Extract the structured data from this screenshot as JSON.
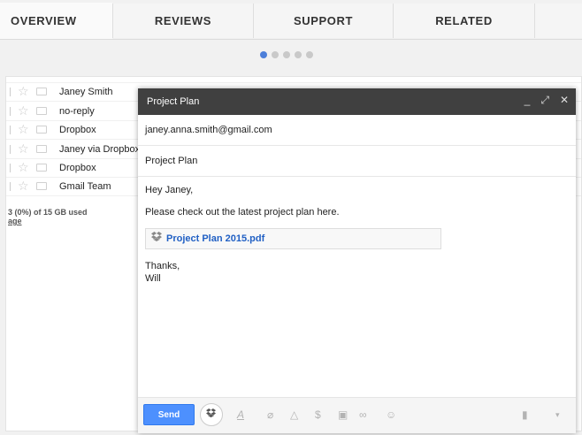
{
  "tabs": [
    {
      "label": "OVERVIEW"
    },
    {
      "label": "REVIEWS"
    },
    {
      "label": "SUPPORT"
    },
    {
      "label": "RELATED"
    }
  ],
  "carousel": {
    "active_index": 0,
    "count": 5
  },
  "inbox": {
    "rows": [
      {
        "sender": "Janey Smith"
      },
      {
        "sender": "no-reply"
      },
      {
        "sender": "Dropbox"
      },
      {
        "sender": "Janey via Dropbox"
      },
      {
        "sender": "Dropbox"
      },
      {
        "sender": "Gmail Team"
      }
    ],
    "storage_text": "3 (0%) of 15 GB used",
    "storage_link": "age"
  },
  "compose": {
    "title": "Project Plan",
    "to": "janey.anna.smith@gmail.com",
    "subject": "Project Plan",
    "greeting": "Hey Janey,",
    "message": "Please check out the latest project plan here.",
    "attachment": "Project Plan 2015.pdf",
    "signoff": "Thanks,",
    "signature": "Will",
    "send_label": "Send"
  },
  "colors": {
    "accent": "#4d90fe",
    "header": "#404040",
    "link": "#2160c4"
  }
}
